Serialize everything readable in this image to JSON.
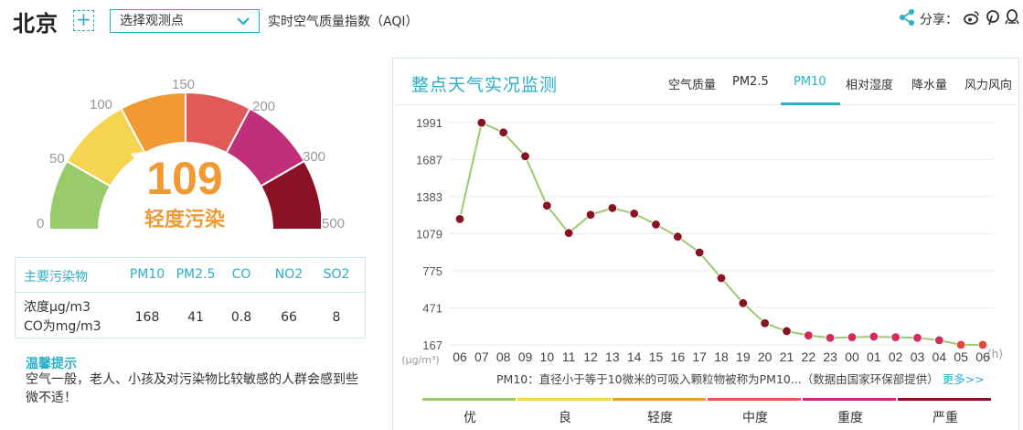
{
  "header": {
    "city": "北京",
    "add_symbol": "+",
    "station_select": "选择观测点",
    "aqi_caption": "实时空气质量指数（AQI）",
    "share_label": "分享："
  },
  "icons": [
    "share-icon",
    "weibo-icon",
    "pinterest-icon",
    "qq-icon",
    "chevron-down-icon",
    "add-icon"
  ],
  "gauge": {
    "value": "109",
    "level": "轻度污染",
    "value_color": "#f19a34",
    "ticks": [
      "0",
      "50",
      "100",
      "150",
      "200",
      "300",
      "500"
    ],
    "segment_colors": [
      "#9acb6a",
      "#f5d451",
      "#f19a34",
      "#e05a57",
      "#c0307a",
      "#8b1125"
    ]
  },
  "pollutants": {
    "label": "主要污染物",
    "row_label_1": "浓度μg/m3",
    "row_label_2": "CO为mg/m3",
    "columns": [
      {
        "name": "PM10",
        "value": "168"
      },
      {
        "name": "PM2.5",
        "value": "41"
      },
      {
        "name": "CO",
        "value": "0.8"
      },
      {
        "name": "NO2",
        "value": "66"
      },
      {
        "name": "SO2",
        "value": "8"
      }
    ]
  },
  "tip": {
    "title": "温馨提示",
    "text": "空气一般，老人、小孩及对污染物比较敏感的人群会感到些微不适！"
  },
  "panel": {
    "title": "整点天气实况监测",
    "tabs": [
      "空气质量",
      "PM2.5",
      "PM10",
      "相对湿度",
      "降水量",
      "风力风向"
    ],
    "active_tab": "PM10",
    "footnote": "PM10：直径小于等于10微米的可吸入颗粒物被称为PM10...（数据由国家环保部提供）",
    "more": "更多>>"
  },
  "chart_data": {
    "type": "line",
    "ylabel": "(μg/m³)",
    "xlabel": "(h)",
    "y_ticks": [
      167,
      471,
      775,
      1079,
      1383,
      1687,
      1991
    ],
    "x": [
      "06",
      "07",
      "08",
      "09",
      "10",
      "11",
      "12",
      "13",
      "14",
      "15",
      "16",
      "17",
      "18",
      "19",
      "20",
      "21",
      "22",
      "23",
      "00",
      "01",
      "02",
      "03",
      "04",
      "05",
      "06"
    ],
    "values": [
      1200,
      1990,
      1910,
      1715,
      1310,
      1085,
      1235,
      1290,
      1245,
      1155,
      1055,
      925,
      715,
      510,
      345,
      280,
      245,
      225,
      230,
      235,
      230,
      225,
      205,
      168,
      168
    ],
    "line_color": "#9acb6a",
    "grid": "horizontal",
    "legend": [
      {
        "label": "优",
        "color": "#9acb6a"
      },
      {
        "label": "良",
        "color": "#f5d451"
      },
      {
        "label": "轻度",
        "color": "#f19a34"
      },
      {
        "label": "中度",
        "color": "#e05a57"
      },
      {
        "label": "重度",
        "color": "#c0307a"
      },
      {
        "label": "严重",
        "color": "#8b1125"
      }
    ]
  }
}
